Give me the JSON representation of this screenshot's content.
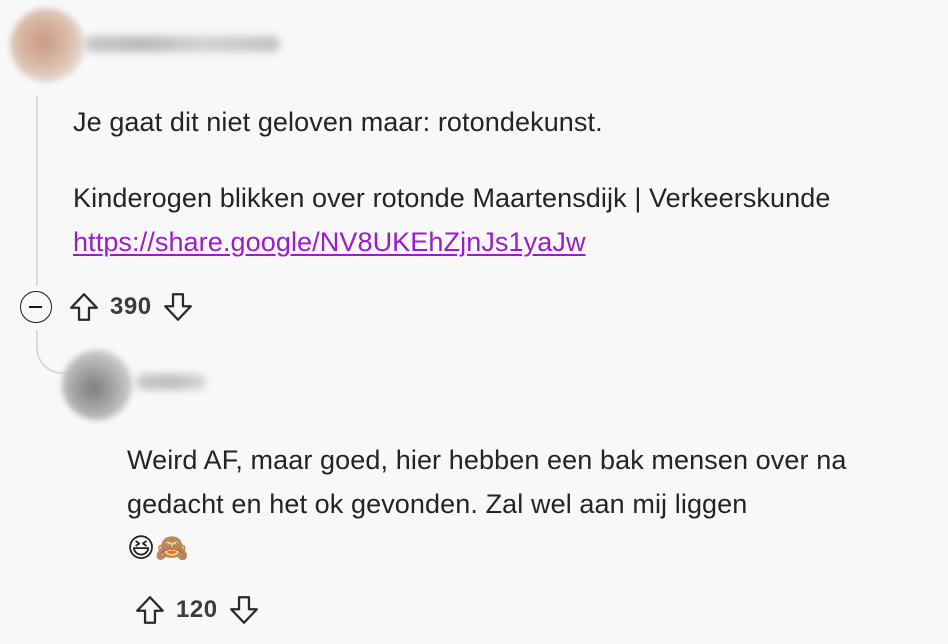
{
  "comments": [
    {
      "paragraphs": [
        "Je gaat dit niet geloven maar: rotondekunst."
      ],
      "link_prefix": "Kinderogen blikken over rotonde Maartensdijk | Verkeerskunde ",
      "link_text": "https://share.google/NV8UKEhZjnJs1yaJw",
      "votes": "390"
    },
    {
      "text": "Weird AF, maar goed, hier hebben een bak mensen over na gedacht en het ok gevonden. Zal wel aan mij liggen",
      "emoji": "😆🙈",
      "votes": "120"
    }
  ],
  "colors": {
    "background": "#f8f8f8",
    "text": "#242424",
    "link": "#9b1cc9",
    "thread_line": "#d8dadc"
  },
  "icons": [
    "collapse-icon",
    "upvote-icon",
    "downvote-icon"
  ]
}
